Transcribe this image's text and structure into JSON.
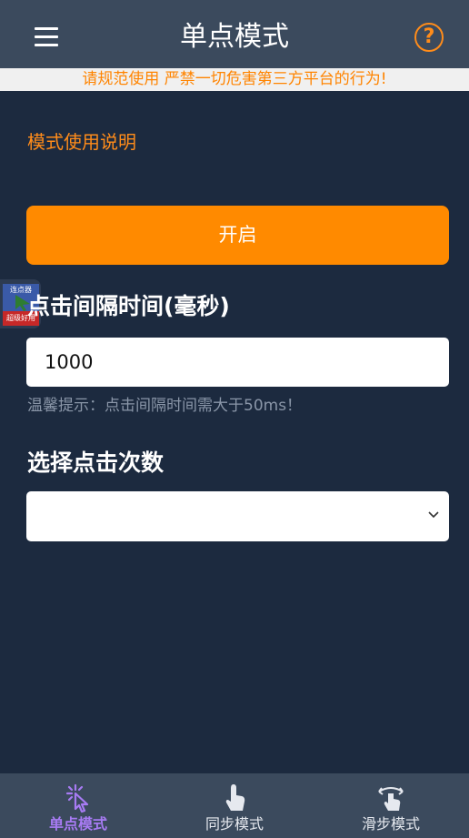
{
  "header": {
    "title": "单点模式",
    "menu_icon": "menu-icon",
    "help_icon": "help-circle-icon",
    "help_symbol": "?"
  },
  "notice": "请规范使用 严禁一切危害第三方平台的行为!",
  "main": {
    "mode_instructions_link": "模式使用说明",
    "start_button": "开启",
    "interval_label": "点击间隔时间(毫秒)",
    "interval_value": "1000",
    "interval_hint": "温馨提示：点击间隔时间需大于50ms！",
    "count_label": "选择点击次数",
    "count_value": ""
  },
  "floating_widget": {
    "top_text": "连点器",
    "bottom_text": "超级好用"
  },
  "tabs": [
    {
      "label": "单点模式",
      "icon": "tap-sparkle-icon",
      "active": true
    },
    {
      "label": "同步模式",
      "icon": "hand-tap-icon",
      "active": false
    },
    {
      "label": "滑步模式",
      "icon": "hand-swipe-icon",
      "active": false
    }
  ],
  "colors": {
    "background": "#1c2a3f",
    "header": "#3b4a5d",
    "accent": "#ff8a00",
    "active_tab": "#a77bf3"
  }
}
